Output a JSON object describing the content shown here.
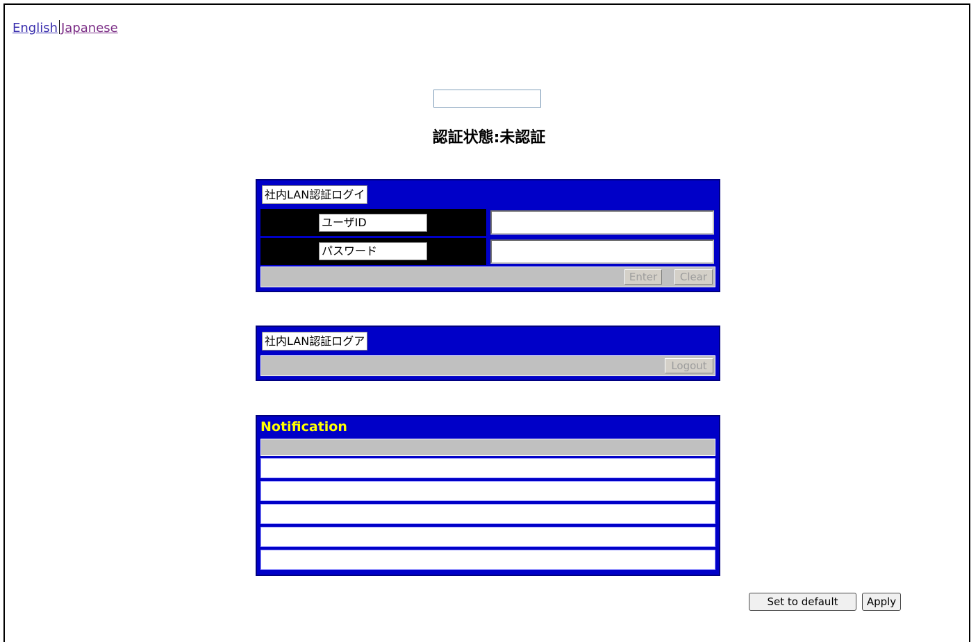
{
  "language_links": {
    "english": "English",
    "japanese": "Japanese"
  },
  "status_text": "認証状態:未認証",
  "login_panel": {
    "title": "社内LAN認証ログイ",
    "user_id_label": "ユーザID",
    "password_label": "パスワード",
    "user_id_value": "",
    "password_value": "",
    "enter_label": "Enter",
    "clear_label": "Clear"
  },
  "logout_panel": {
    "title": "社内LAN認証ログア",
    "logout_label": "Logout"
  },
  "notification_panel": {
    "title": "Notification",
    "rows": [
      "",
      "",
      "",
      "",
      ""
    ]
  },
  "footer_buttons": {
    "set_default_label": "Set to default",
    "apply_label": "Apply"
  },
  "colors": {
    "panel_blue": "#0000c8",
    "notification_title": "#ffff00",
    "row_gray": "#c0c0c0"
  }
}
